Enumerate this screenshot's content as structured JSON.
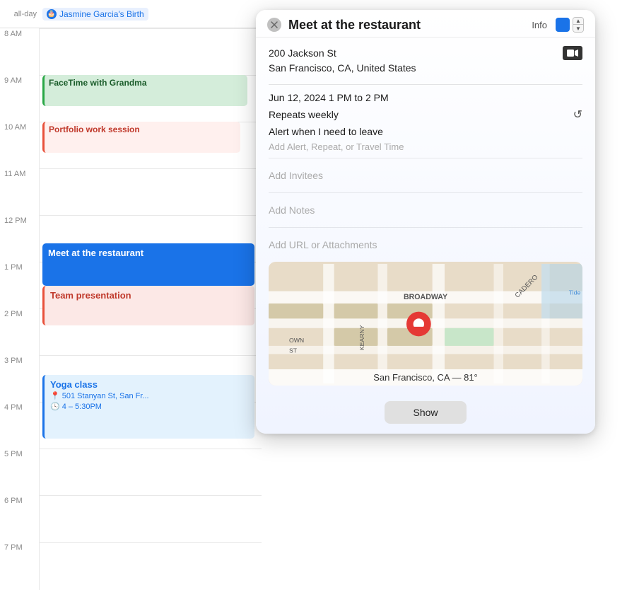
{
  "calendar": {
    "all_day_label": "all-day",
    "all_day_event": "Jasmine Garcia's Birth",
    "times": [
      "8 AM",
      "9 AM",
      "10 AM",
      "11 AM",
      "12 PM",
      "1 PM",
      "2 PM",
      "3 PM",
      "4 PM",
      "5 PM",
      "6 PM",
      "7 PM"
    ],
    "events": {
      "facetime": "FaceTime with Grandma",
      "portfolio": "Portfolio work session",
      "restaurant": "Meet at the restaurant",
      "team": "Team presentation",
      "yoga": "Yoga class",
      "yoga_location": "501 Stanyan St, San Fr...",
      "yoga_time": "4 – 5:30PM"
    }
  },
  "popup": {
    "info_label": "Info",
    "title": "Meet at the restaurant",
    "location_line1": "200 Jackson St",
    "location_line2": "San Francisco, CA, United States",
    "date_time": "Jun 12, 2024  1 PM to 2 PM",
    "repeats": "Repeats weekly",
    "alert": "Alert when I need to leave",
    "add_alert_placeholder": "Add Alert, Repeat, or Travel Time",
    "add_invitees": "Add Invitees",
    "add_notes": "Add Notes",
    "add_url": "Add URL or Attachments",
    "map_label": "San Francisco, CA — 81°",
    "show_button": "Show",
    "calendar_color": "#1a73e8"
  }
}
